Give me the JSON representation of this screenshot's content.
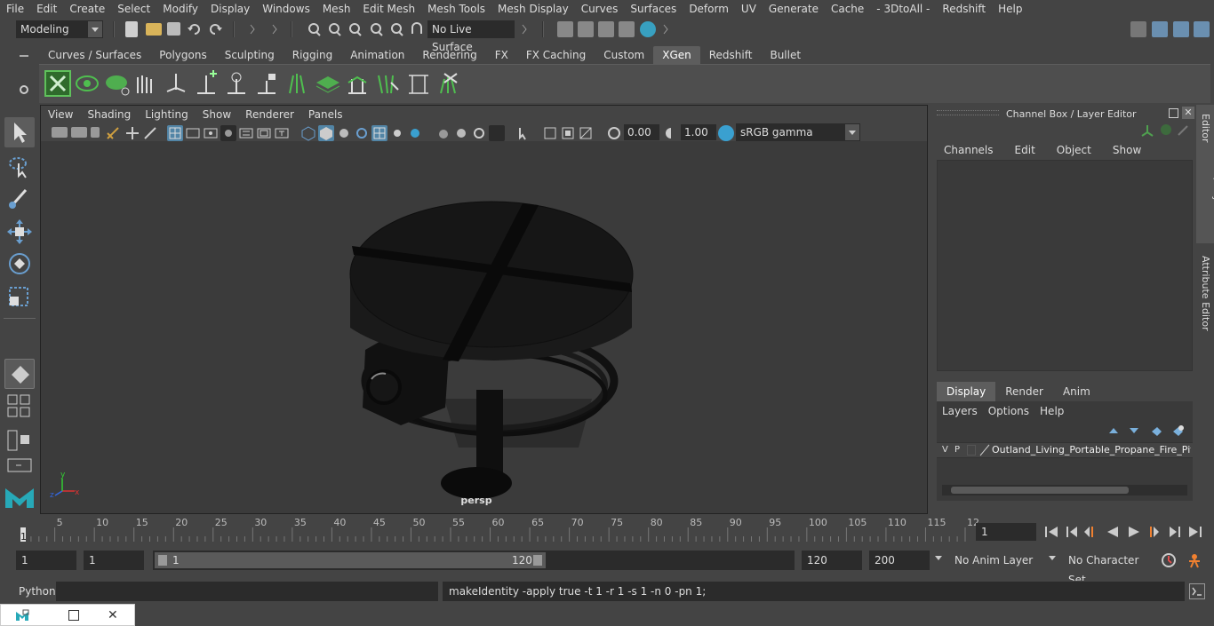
{
  "menu": [
    "File",
    "Edit",
    "Create",
    "Select",
    "Modify",
    "Display",
    "Windows",
    "Mesh",
    "Edit Mesh",
    "Mesh Tools",
    "Mesh Display",
    "Curves",
    "Surfaces",
    "Deform",
    "UV",
    "Generate",
    "Cache",
    "- 3DtoAll -",
    "Redshift",
    "Help"
  ],
  "status": {
    "mode": "Modeling",
    "live_surface": "No Live Surface"
  },
  "shelf_tabs": [
    "Curves / Surfaces",
    "Polygons",
    "Sculpting",
    "Rigging",
    "Animation",
    "Rendering",
    "FX",
    "FX Caching",
    "Custom",
    "XGen",
    "Redshift",
    "Bullet"
  ],
  "shelf_active": "XGen",
  "viewport": {
    "menu": [
      "View",
      "Shading",
      "Lighting",
      "Show",
      "Renderer",
      "Panels"
    ],
    "exposure": "0.00",
    "gamma": "1.00",
    "color_space": "sRGB gamma",
    "camera_label": "persp"
  },
  "channel_box": {
    "title": "Channel Box / Layer Editor",
    "menu": [
      "Channels",
      "Edit",
      "Object",
      "Show"
    ],
    "tabs": [
      "Display",
      "Render",
      "Anim"
    ],
    "active_tab": "Display",
    "layer_menu": [
      "Layers",
      "Options",
      "Help"
    ],
    "layer": {
      "v": "V",
      "p": "P",
      "name": "Outland_Living_Portable_Propane_Fire_Pit_"
    }
  },
  "side_tabs": {
    "channel": "Channel Box / Layer Editor",
    "attr": "Attribute Editor"
  },
  "timeline": {
    "ticks": [
      "5",
      "10",
      "15",
      "20",
      "25",
      "30",
      "35",
      "40",
      "45",
      "50",
      "55",
      "60",
      "65",
      "70",
      "75",
      "80",
      "85",
      "90",
      "95",
      "100",
      "105",
      "110",
      "115",
      "12"
    ],
    "start_marker": "1",
    "current_frame": "1"
  },
  "range": {
    "start": "1",
    "anim_start": "1",
    "slider_start": "1",
    "slider_end": "120",
    "end": "120",
    "anim_end": "200",
    "anim_layer": "No Anim Layer",
    "char_set": "No Character Set"
  },
  "command": {
    "lang": "Python",
    "result": "makeIdentity -apply true -t 1 -r 1 -s 1 -n 0 -pn 1;"
  },
  "colors": {
    "accent": "#5d5d5d",
    "xgen_green": "#3c9a42",
    "selected_blue": "#5285a6"
  }
}
